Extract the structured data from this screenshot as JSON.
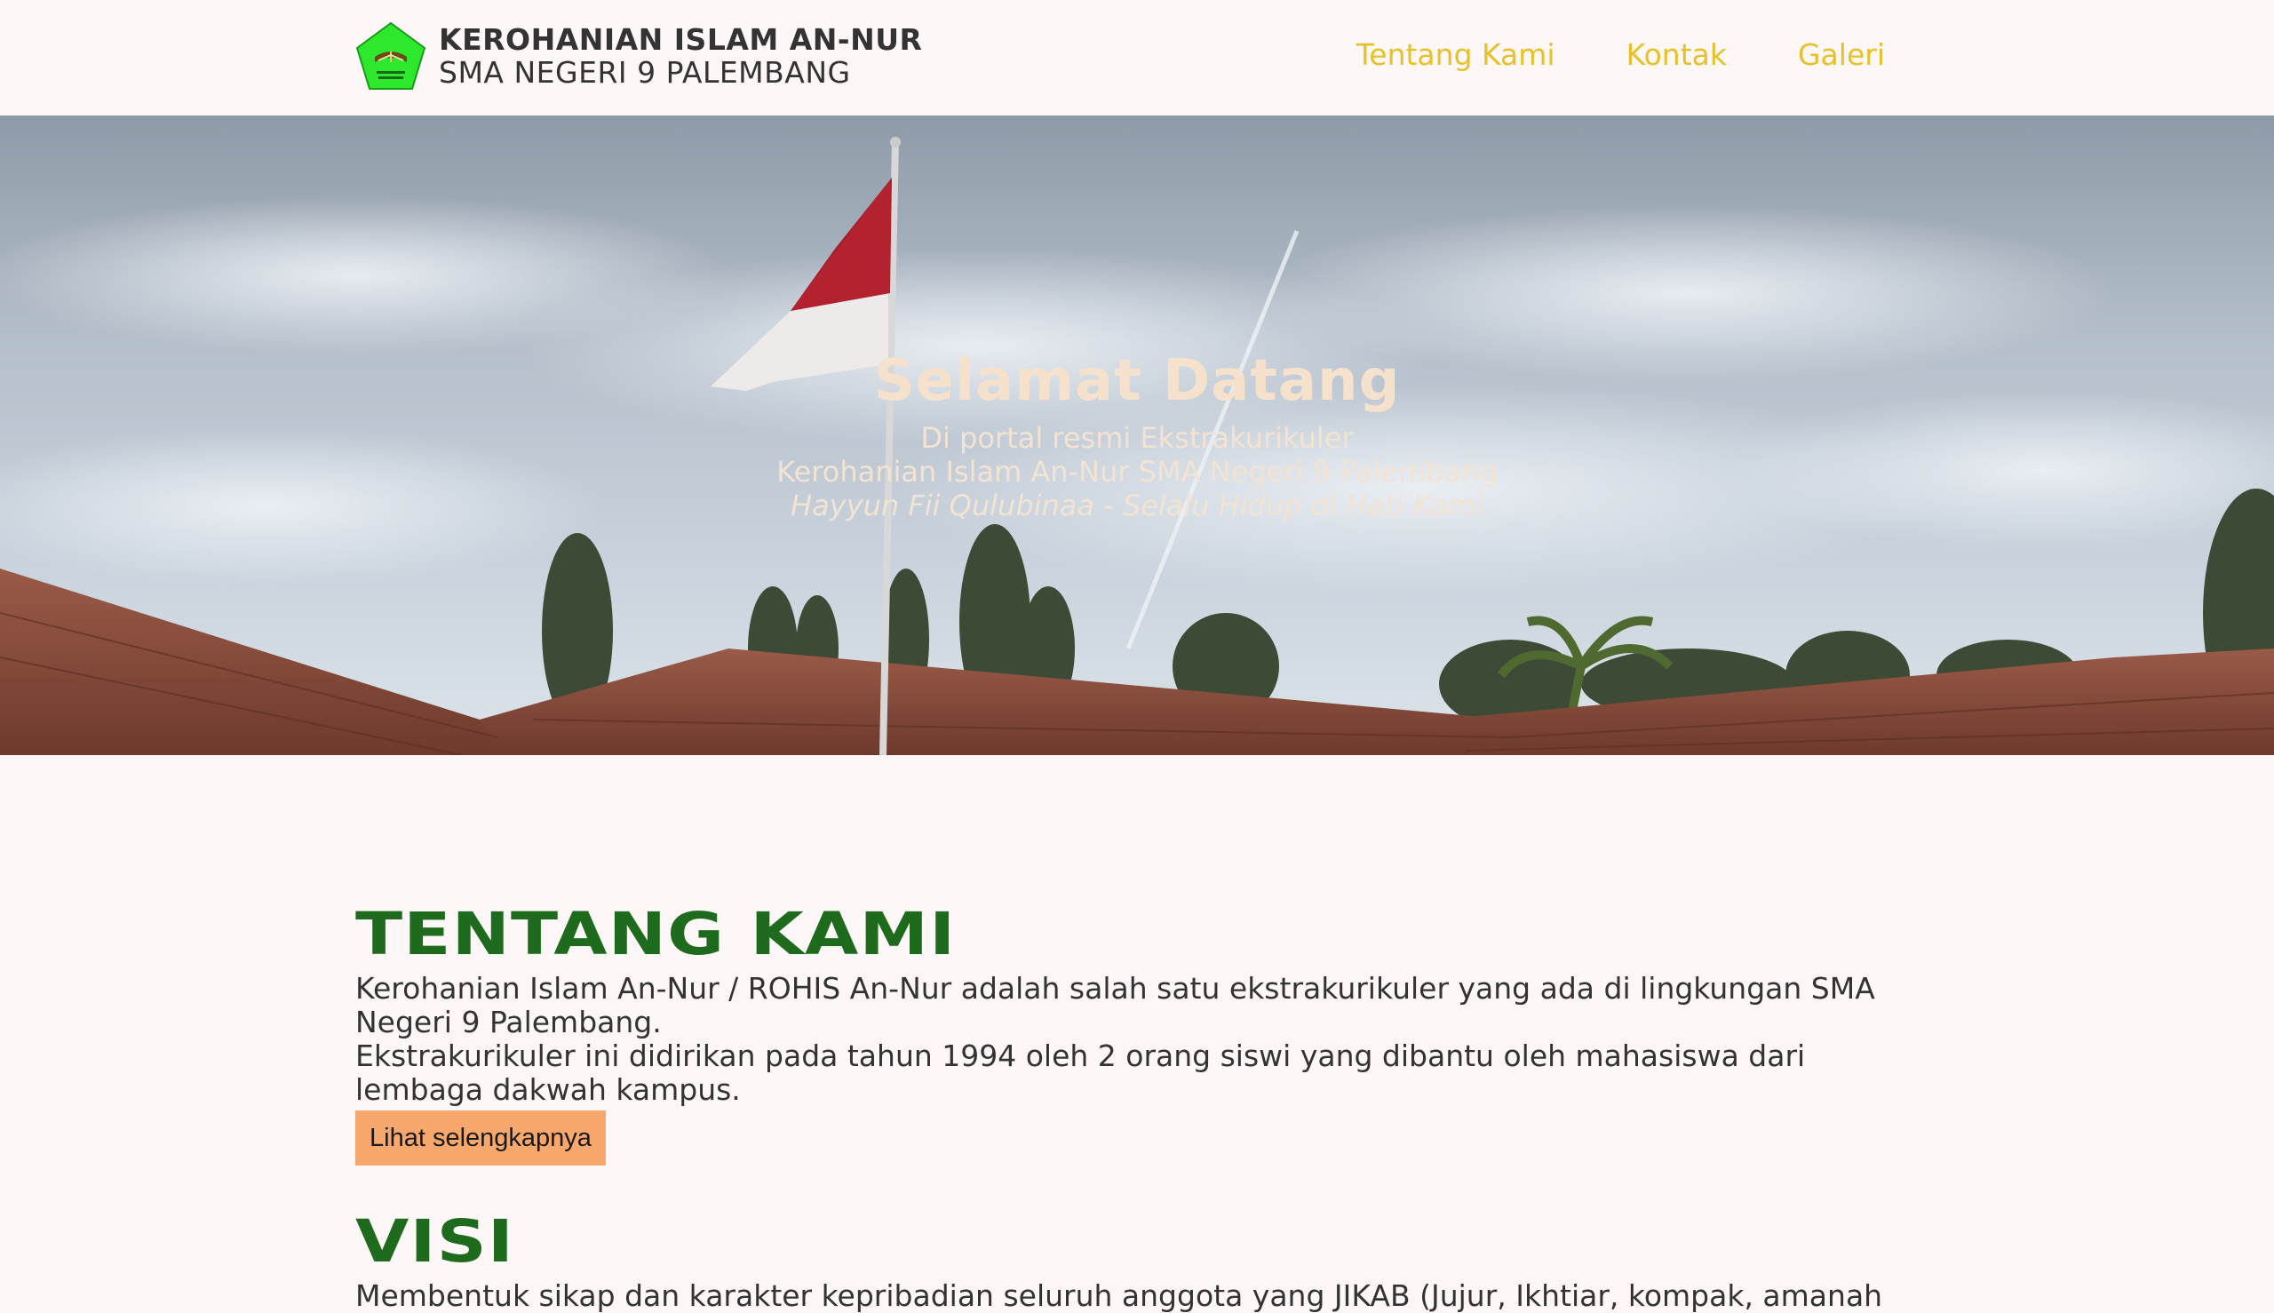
{
  "header": {
    "org_title": "KEROHANIAN ISLAM AN-NUR",
    "org_subtitle": "SMA NEGERI 9 PALEMBANG",
    "logo_icon": "rohis-logo-pentagon-icon",
    "nav": [
      {
        "label": "Tentang Kami"
      },
      {
        "label": "Kontak"
      },
      {
        "label": "Galeri"
      }
    ]
  },
  "hero": {
    "title": "Selamat Datang",
    "line1": "Di portal resmi Ekstrakurikuler",
    "line2": "Kerohanian Islam An-Nur SMA Negeri 9 Palembang",
    "tagline": "Hayyun Fii Qulubinaa - Selalu Hidup di Hati Kami"
  },
  "about": {
    "heading": "TENTANG KAMI",
    "paragraph1": "Kerohanian Islam An-Nur / ROHIS An-Nur adalah salah satu ekstrakurikuler yang ada di lingkungan SMA Negeri 9 Palembang.",
    "paragraph2": "Ekstrakurikuler ini didirikan pada tahun 1994 oleh 2 orang siswi yang dibantu oleh mahasiswa dari lembaga dakwah kampus.",
    "button_label": "Lihat selengkapnya"
  },
  "visi": {
    "heading": "VISI",
    "text": "Membentuk sikap dan karakter kepribadian seluruh anggota yang JIKAB (Jujur, Ikhtiar, kompak, amanah"
  },
  "colors": {
    "background": "#fdf8f7",
    "nav_link": "#e6c12a",
    "heading_green": "#1e6b1e",
    "button": "#f9a86d",
    "logo_green": "#2ee82e"
  }
}
